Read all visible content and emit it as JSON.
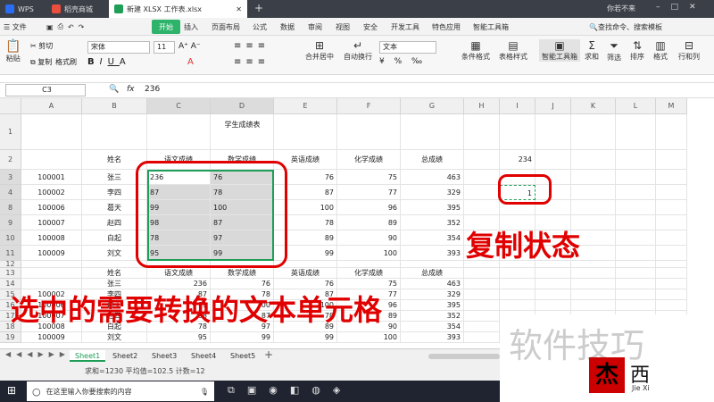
{
  "titlebar": {
    "tabs": [
      {
        "label": "WPS"
      },
      {
        "label": "稻壳商城"
      },
      {
        "label": "新建 XLSX 工作表.xlsx"
      }
    ],
    "user": "你若不来"
  },
  "menu": {
    "file": "文件",
    "items": [
      "开始",
      "插入",
      "页面布局",
      "公式",
      "数据",
      "审阅",
      "视图",
      "安全",
      "开发工具",
      "特色应用",
      "智能工具箱"
    ],
    "search": "查找命令、搜索模板"
  },
  "ribbon": {
    "paste": "粘贴",
    "cut": "剪切",
    "copy": "复制",
    "format_painter": "格式刷",
    "font": "宋体",
    "font_size": "11",
    "merge": "合并居中",
    "wrap": "自动换行",
    "num_format": "文本",
    "cond_format": "条件格式",
    "table_style": "表格样式",
    "smart_tool": "智能工具箱",
    "sum": "求和",
    "filter": "筛选",
    "sort": "排序",
    "format": "格式",
    "rowcol": "行和列"
  },
  "formula": {
    "cell_ref": "C3",
    "fx": "fx",
    "value": "236"
  },
  "columns": [
    "A",
    "B",
    "C",
    "D",
    "E",
    "F",
    "G",
    "H",
    "I",
    "J",
    "K",
    "L",
    "M"
  ],
  "sheet": {
    "title": "学生成绩表",
    "headers": [
      "姓名",
      "语文成绩",
      "数学成绩",
      "英语成绩",
      "化学成绩",
      "总成绩"
    ],
    "i2": "234",
    "i4": "1",
    "rows": [
      [
        "100001",
        "张三",
        "236",
        "76",
        "76",
        "75",
        "463"
      ],
      [
        "100002",
        "李四",
        "87",
        "78",
        "87",
        "77",
        "329"
      ],
      [
        "100006",
        "葛天",
        "99",
        "100",
        "100",
        "96",
        "395"
      ],
      [
        "100007",
        "赵四",
        "98",
        "87",
        "78",
        "89",
        "352"
      ],
      [
        "100008",
        "白起",
        "78",
        "97",
        "89",
        "90",
        "354"
      ],
      [
        "100009",
        "刘文",
        "95",
        "99",
        "99",
        "100",
        "393"
      ]
    ],
    "lower_headers": [
      "姓名",
      "语文成绩",
      "数学成绩",
      "英语成绩",
      "化学成绩",
      "总成绩"
    ],
    "lower_rows": [
      [
        "",
        "张三",
        "236",
        "76",
        "76",
        "75",
        "463"
      ],
      [
        "100002",
        "李四",
        "87",
        "78",
        "87",
        "77",
        "329"
      ],
      [
        "100006",
        "葛天",
        "99",
        "100",
        "100",
        "96",
        "395"
      ],
      [
        "100007",
        "赵四",
        "98",
        "87",
        "78",
        "89",
        "352"
      ],
      [
        "100008",
        "白起",
        "78",
        "97",
        "89",
        "90",
        "354"
      ],
      [
        "100009",
        "刘文",
        "95",
        "99",
        "99",
        "100",
        "393"
      ]
    ]
  },
  "sheet_tabs": [
    "Sheet1",
    "Sheet2",
    "Sheet3",
    "Sheet4",
    "Sheet5"
  ],
  "status": "求和=1230 平均值=102.5 计数=12",
  "taskbar": {
    "search": "在这里输入你要搜索的内容"
  },
  "overlays": {
    "copy_state": "复制状态",
    "select_text": "选中的需要转换的文本单元格",
    "watermark": "软件技巧",
    "logo_small": "Jie Xi",
    "logo_char": "西"
  },
  "colors": {
    "accent": "#1e9e56",
    "annotation": "#e00000"
  }
}
